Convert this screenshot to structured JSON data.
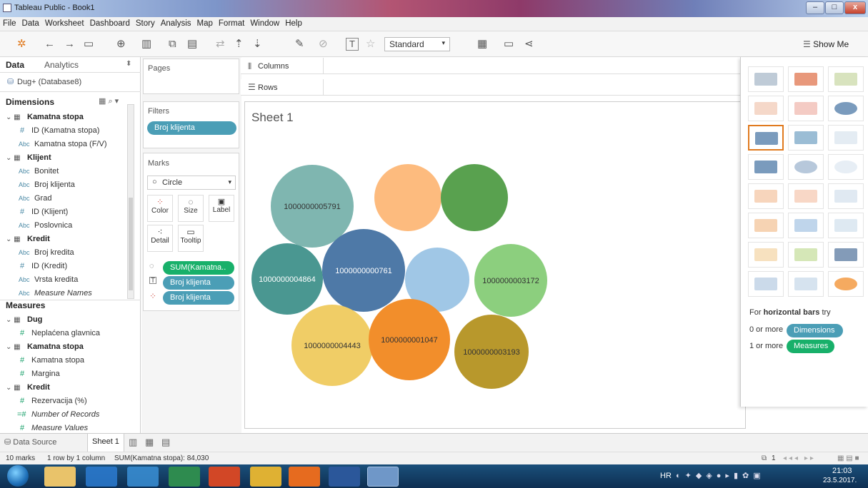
{
  "window": {
    "title": "Tableau Public - Book1",
    "min": "–",
    "max": "□",
    "close": "x"
  },
  "menu": [
    "File",
    "Data",
    "Worksheet",
    "Dashboard",
    "Story",
    "Analysis",
    "Map",
    "Format",
    "Window",
    "Help"
  ],
  "toolbar": {
    "format_select": "Standard",
    "show_me": "Show Me"
  },
  "data_pane": {
    "tab_data": "Data",
    "tab_analytics": "Analytics",
    "source": "Dug+ (Database8)",
    "dimensions_header": "Dimensions",
    "measures_header": "Measures",
    "dimensions": [
      {
        "kind": "table",
        "label": "Kamatna stopa"
      },
      {
        "kind": "#",
        "label": "ID (Kamatna stopa)"
      },
      {
        "kind": "Abc",
        "label": "Kamatna stopa (F/V)"
      },
      {
        "kind": "table",
        "label": "Klijent"
      },
      {
        "kind": "Abc",
        "label": "Bonitet"
      },
      {
        "kind": "Abc",
        "label": "Broj klijenta"
      },
      {
        "kind": "Abc",
        "label": "Grad"
      },
      {
        "kind": "#",
        "label": "ID (Klijent)"
      },
      {
        "kind": "Abc",
        "label": "Poslovnica"
      },
      {
        "kind": "table",
        "label": "Kredit"
      },
      {
        "kind": "Abc",
        "label": "Broj kredita"
      },
      {
        "kind": "#",
        "label": "ID (Kredit)"
      },
      {
        "kind": "Abc",
        "label": "Vrsta kredita"
      },
      {
        "kind": "Abc",
        "label": "Measure Names"
      }
    ],
    "measures": [
      {
        "kind": "table",
        "label": "Dug"
      },
      {
        "kind": "#",
        "label": "Neplaćena glavnica"
      },
      {
        "kind": "table",
        "label": "Kamatna stopa"
      },
      {
        "kind": "#",
        "label": "Kamatna stopa"
      },
      {
        "kind": "#",
        "label": "Margina"
      },
      {
        "kind": "table",
        "label": "Kredit"
      },
      {
        "kind": "#",
        "label": "Rezervacija (%)"
      },
      {
        "kind": "=#",
        "label": "Number of Records"
      },
      {
        "kind": "#",
        "label": "Measure Values"
      }
    ]
  },
  "shelves": {
    "pages": "Pages",
    "filters": "Filters",
    "filter_pill": "Broj klijenta",
    "marks": "Marks",
    "mark_type": "Circle",
    "color": "Color",
    "size": "Size",
    "label": "Label",
    "detail": "Detail",
    "tooltip": "Tooltip",
    "mark_pills": [
      "SUM(Kamatna..",
      "Broj klijenta",
      "Broj klijenta"
    ],
    "columns": "Columns",
    "rows": "Rows"
  },
  "sheet_title": "Sheet 1",
  "chart_data": {
    "type": "packed-bubbles",
    "bubbles": [
      {
        "label": "1000000005791",
        "color": "#7fb6b0"
      },
      {
        "label": "",
        "color": "#fdbb7e"
      },
      {
        "label": "",
        "color": "#59a14f"
      },
      {
        "label": "1000000004864",
        "color": "#4a9791"
      },
      {
        "label": "1000000000761",
        "color": "#4e79a7"
      },
      {
        "label": "",
        "color": "#a0c7e6"
      },
      {
        "label": "1000000003172",
        "color": "#8ccf7e"
      },
      {
        "label": "1000000004443",
        "color": "#f0cd66"
      },
      {
        "label": "1000000001047",
        "color": "#f28e2b"
      },
      {
        "label": "1000000003193",
        "color": "#b8982c"
      }
    ]
  },
  "show_me": {
    "hint_prefix": "For ",
    "hint_bold": "horizontal bars",
    "hint_suffix": " try",
    "dim_prefix": "0 or more",
    "dim_pill": "Dimensions",
    "mea_prefix": "1 or more",
    "mea_pill": "Measures"
  },
  "tabs": {
    "data_source": "Data Source",
    "sheet": "Sheet 1"
  },
  "status": {
    "marks": "10 marks",
    "rows": "1 row by 1 column",
    "sum": "SUM(Kamatna stopa): 84,030",
    "page": "1"
  },
  "taskbar": {
    "lang": "HR",
    "time": "21:03",
    "date": "23.5.2017."
  }
}
